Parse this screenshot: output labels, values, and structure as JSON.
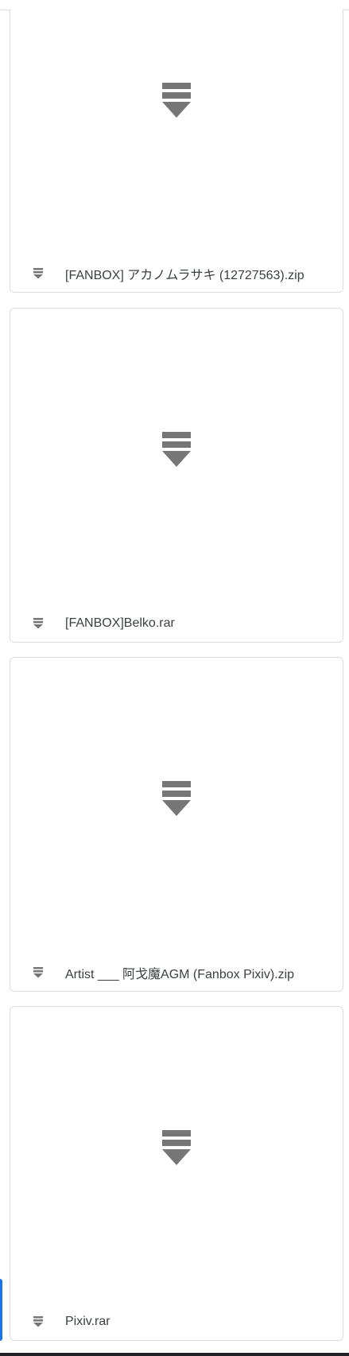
{
  "icons": {
    "thumbnail": "archive-icon",
    "file_type": "archive-icon",
    "color": "#767676"
  },
  "files": [
    {
      "name": "[FANBOX] アカノムラサキ (12727563).zip"
    },
    {
      "name": "[FANBOX]Belko.rar"
    },
    {
      "name": "Artist ___ 阿戈魔AGM (Fanbox Pixiv).zip"
    },
    {
      "name": "Pixiv.rar"
    }
  ]
}
